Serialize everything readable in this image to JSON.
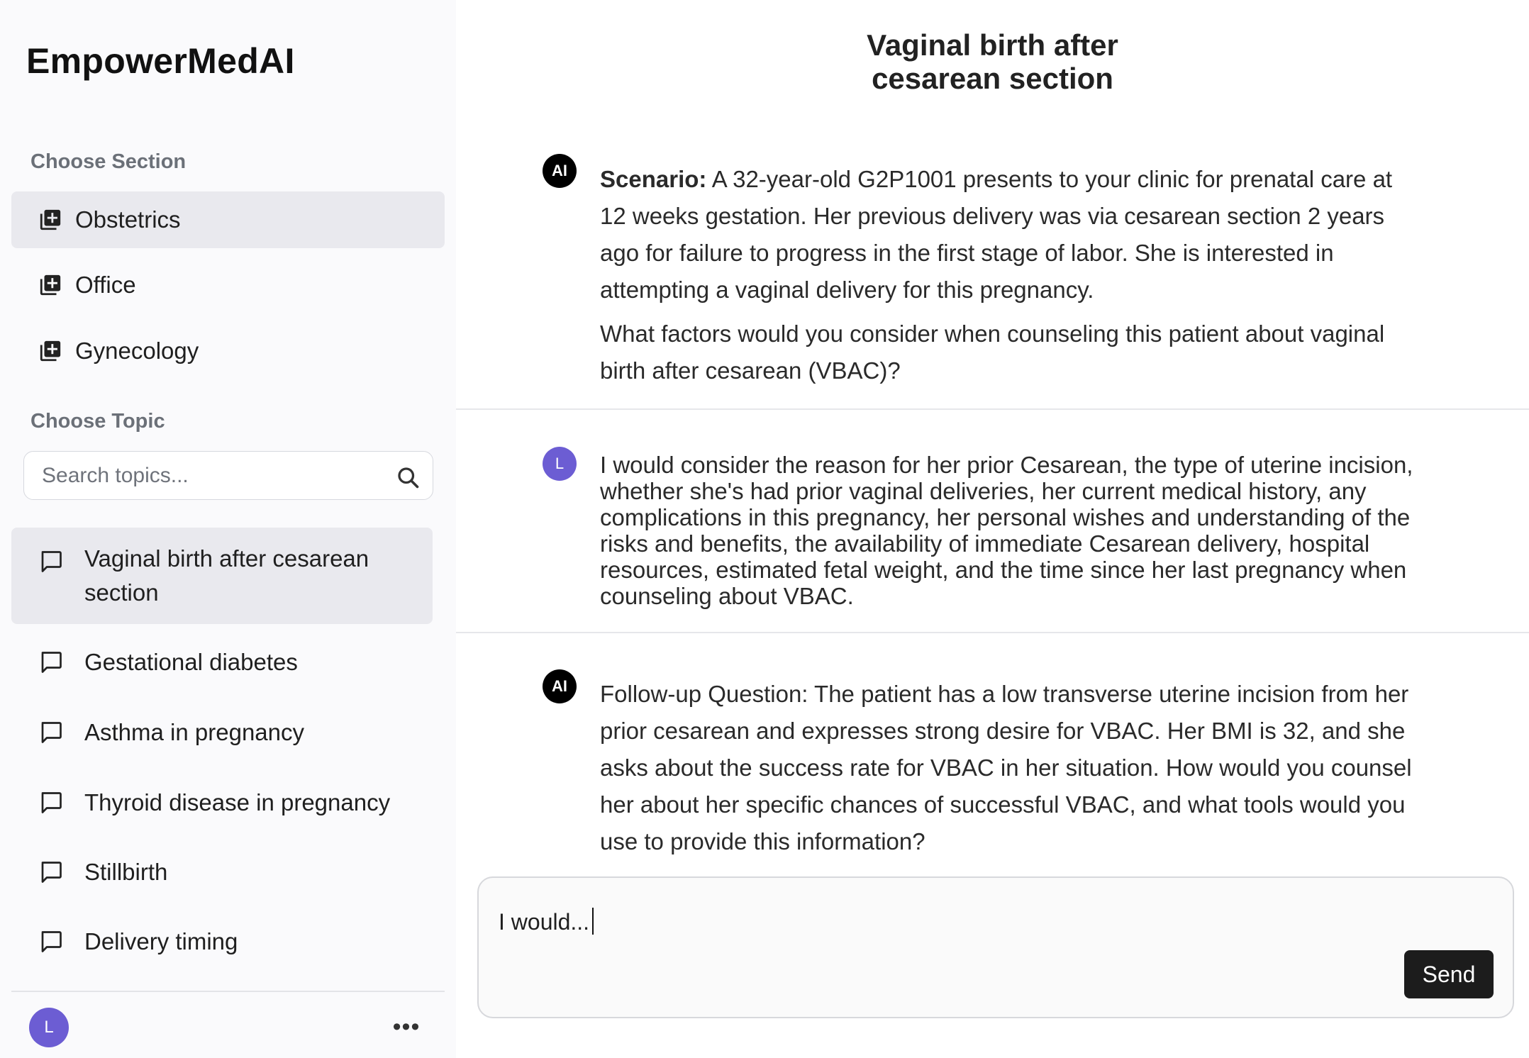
{
  "app": {
    "name": "EmpowerMedAI"
  },
  "sidebar": {
    "section_label": "Choose Section",
    "sections": [
      {
        "label": "Obstetrics",
        "active": true
      },
      {
        "label": "Office",
        "active": false
      },
      {
        "label": "Gynecology",
        "active": false
      }
    ],
    "topic_label": "Choose Topic",
    "search": {
      "placeholder": "Search topics..."
    },
    "topics": [
      {
        "label": "Vaginal birth after cesarean section",
        "active": true
      },
      {
        "label": "Gestational diabetes"
      },
      {
        "label": "Asthma in pregnancy"
      },
      {
        "label": "Thyroid disease in pregnancy"
      },
      {
        "label": "Stillbirth"
      },
      {
        "label": "Delivery timing"
      }
    ],
    "user": {
      "initial": "L"
    },
    "more_label": "•••"
  },
  "main": {
    "title_line1": "Vaginal birth after",
    "title_line2": "cesarean section",
    "messages": [
      {
        "role": "ai",
        "avatar": "AI",
        "scenario_label": "Scenario:",
        "scenario_text": " A 32-year-old G2P1001 presents to your clinic for prenatal care at 12 weeks gestation. Her previous delivery was via cesarean section 2 years ago for failure to progress in the first stage of labor. She is interested in attempting a vaginal delivery for this pregnancy.",
        "question": "What factors would you consider when counseling this patient about vaginal birth after cesarean (VBAC)?"
      },
      {
        "role": "user",
        "avatar": "L",
        "text": "I would consider the reason for her prior Cesarean, the type of uterine incision, whether she's had prior vaginal deliveries, her current medical history, any complications in this pregnancy, her personal wishes and understanding of the risks and benefits, the availability of immediate Cesarean delivery, hospital resources, estimated fetal weight, and the time since her last pregnancy when counseling about VBAC."
      },
      {
        "role": "ai",
        "avatar": "AI",
        "text": "Follow-up Question: The patient has a low transverse uterine incision from her prior cesarean and expresses strong desire for VBAC. Her BMI is 32, and she asks about the success rate for VBAC in her situation. How would you counsel her about her specific chances of successful VBAC, and what tools would you use to provide this information?"
      }
    ],
    "composer": {
      "value": "I would...",
      "send_label": "Send"
    }
  },
  "colors": {
    "accent": "#6c5dd3",
    "active_bg": "#e9e9ee",
    "send_bg": "#1c1c1c"
  }
}
